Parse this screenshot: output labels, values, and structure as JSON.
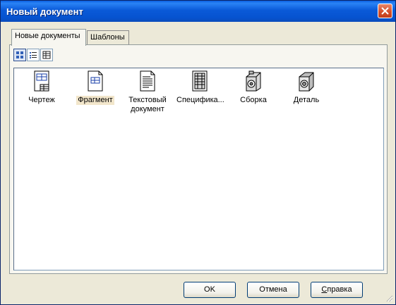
{
  "window": {
    "title": "Новый документ"
  },
  "tabs": [
    {
      "label": "Новые документы",
      "active": true
    },
    {
      "label": "Шаблоны",
      "active": false
    }
  ],
  "view_toolbar": [
    {
      "icon": "large-icons-view-icon",
      "pressed": true
    },
    {
      "icon": "list-view-icon",
      "pressed": false
    },
    {
      "icon": "details-view-icon",
      "pressed": false
    }
  ],
  "items": [
    {
      "label": "Чертеж",
      "icon": "drawing-icon",
      "selected": false
    },
    {
      "label": "Фрагмент",
      "icon": "fragment-icon",
      "selected": true
    },
    {
      "label": "Текстовый документ",
      "line1": "Текстовый",
      "line2": "документ",
      "icon": "text-document-icon",
      "selected": false
    },
    {
      "label": "Спецификa...",
      "icon": "specification-icon",
      "selected": false
    },
    {
      "label": "Сборка",
      "icon": "assembly-icon",
      "selected": false
    },
    {
      "label": "Деталь",
      "icon": "part-icon",
      "selected": false
    }
  ],
  "buttons": {
    "ok": "OK",
    "cancel": "Отмена",
    "help_underlined": "С",
    "help_rest": "правка"
  },
  "colors": {
    "titlebar": "#0a5ad8",
    "close": "#d5502c",
    "selection": "#f2e6cb"
  }
}
